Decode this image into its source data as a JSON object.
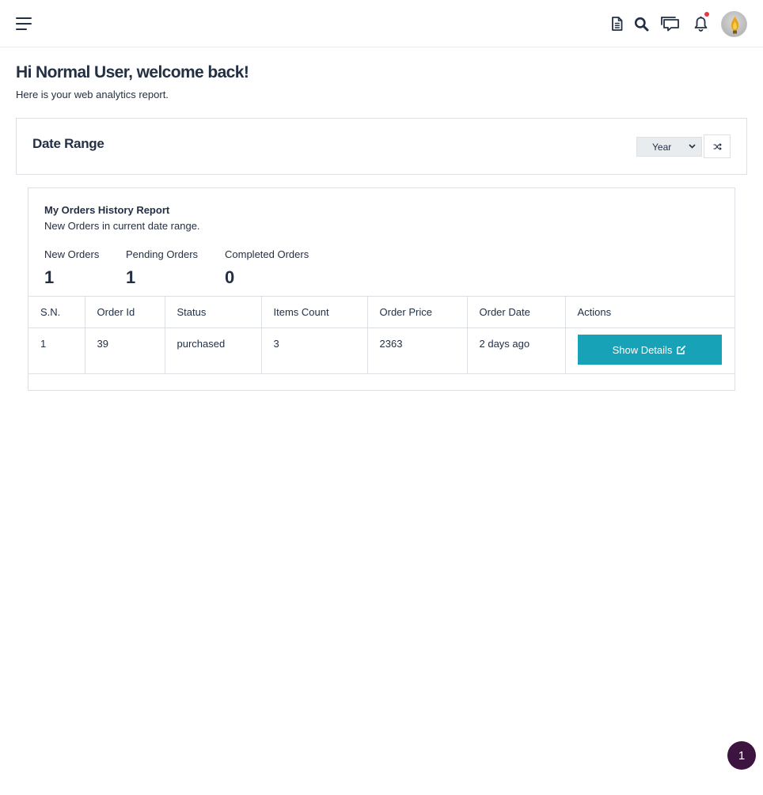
{
  "header": {
    "icons": [
      "menu-icon",
      "document-icon",
      "search-icon",
      "chat-icon",
      "bell-icon",
      "avatar"
    ],
    "has_notification": true
  },
  "welcome": {
    "title": "Hi Normal User, welcome back!",
    "subtitle": "Here is your web analytics report."
  },
  "date_range": {
    "title": "Date Range",
    "selected": "Year",
    "refresh_icon": "shuffle-icon"
  },
  "orders": {
    "title": "My Orders History Report",
    "subtitle": "New Orders in current date range.",
    "stats": [
      {
        "label": "New Orders",
        "value": "1"
      },
      {
        "label": "Pending Orders",
        "value": "1"
      },
      {
        "label": "Completed Orders",
        "value": "0"
      }
    ],
    "columns": [
      "S.N.",
      "Order Id",
      "Status",
      "Items Count",
      "Order Price",
      "Order Date",
      "Actions"
    ],
    "rows": [
      {
        "sn": "1",
        "order_id": "39",
        "status": "purchased",
        "items_count": "3",
        "order_price": "2363",
        "order_date": "2 days ago",
        "action_label": "Show Details"
      }
    ]
  },
  "floating_badge": "1",
  "colors": {
    "primary_text": "#233044",
    "button": "#17a2b8",
    "badge": "#3d1340",
    "notification": "#e63946"
  }
}
